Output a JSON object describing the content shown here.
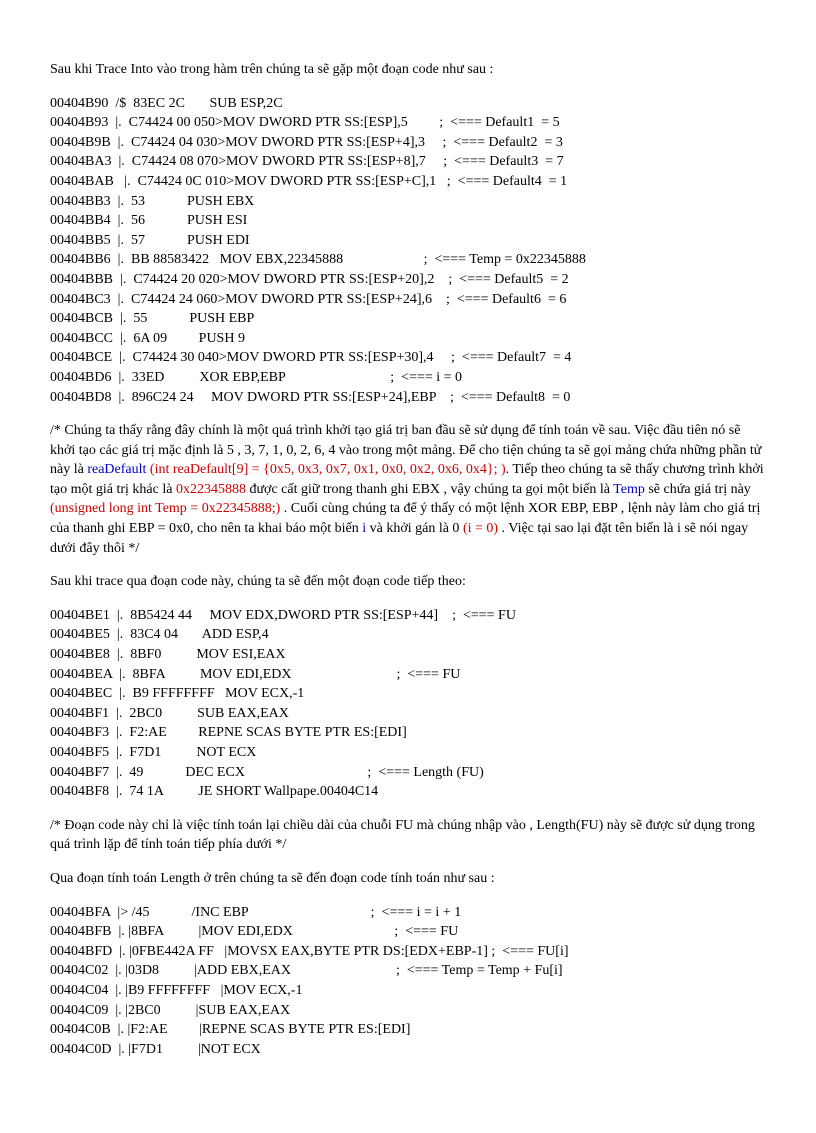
{
  "p1": "Sau khi Trace Into vào trong hàm trên chúng ta sẽ gặp một đoạn code như sau :",
  "code1": "00404B90  /$  83EC 2C       SUB ESP,2C\n00404B93  |.  C74424 00 050>MOV DWORD PTR SS:[ESP],5         ;  <=== Default1  = 5\n00404B9B  |.  C74424 04 030>MOV DWORD PTR SS:[ESP+4],3     ;  <=== Default2  = 3\n00404BA3  |.  C74424 08 070>MOV DWORD PTR SS:[ESP+8],7     ;  <=== Default3  = 7\n00404BAB   |.  C74424 0C 010>MOV DWORD PTR SS:[ESP+C],1   ;  <=== Default4  = 1\n00404BB3  |.  53            PUSH EBX\n00404BB4  |.  56            PUSH ESI\n00404BB5  |.  57            PUSH EDI\n00404BB6  |.  BB 88583422   MOV EBX,22345888                       ;  <=== Temp = 0x22345888\n00404BBB  |.  C74424 20 020>MOV DWORD PTR SS:[ESP+20],2    ;  <=== Default5  = 2\n00404BC3  |.  C74424 24 060>MOV DWORD PTR SS:[ESP+24],6    ;  <=== Default6  = 6\n00404BCB  |.  55            PUSH EBP\n00404BCC  |.  6A 09         PUSH 9\n00404BCE  |.  C74424 30 040>MOV DWORD PTR SS:[ESP+30],4     ;  <=== Default7  = 4\n00404BD6  |.  33ED          XOR EBP,EBP                              ;  <=== i = 0\n00404BD8  |.  896C24 24     MOV DWORD PTR SS:[ESP+24],EBP    ;  <=== Default8  = 0",
  "p2a": "/* Chúng ta thấy rằng đây chính là một quá trình khởi tạo giá trị ban đầu sẽ sử dụng để tính toán về sau.  Việc đầu tiên nó sẽ khởi tạo các giá trị mặc định là 5 , 3, 7, 1, 0, 2, 6, 4 vào trong  một mảng.  Để cho tiện chúng ta sẽ gọi mảng chứa những phần tử này là ",
  "p2b": "reaDefault",
  "p2c": " (int reaDefault[9]  = {0x5, 0x3, 0x7, 0x1, 0x0, 0x2, 0x6, 0x4}; )",
  "p2d": ". Tiếp theo chúng ta sẽ thấy chương trình khởi tạo một giá trị khác là ",
  "p2e": "0x22345888",
  "p2f": " được cất giữ trong thanh ghi EBX , vậy chúng ta gọi một biến là ",
  "p2g": "Temp",
  "p2h": " sẽ chứa giá trị này ",
  "p2i": "(unsigned long int Temp = 0x22345888;)",
  "p2j": " . Cuối cùng chúng ta để ý thấy có một lệnh XOR EBP, EBP , lệnh này làm cho giá trị của thanh ghi EBP = 0x0, cho nên ta khai báo một biến ",
  "p2k": "i",
  "p2l": " và khởi gán là 0 ",
  "p2m": "(i = 0)",
  "p2n": " . Việc tại sao lại đặt tên biến là i sẽ nói ngay dưới đây thôi */",
  "p3": "Sau khi trace qua đoạn code này, chúng ta sẽ đến một đoạn code tiếp theo:",
  "code2": "00404BE1  |.  8B5424 44     MOV EDX,DWORD PTR SS:[ESP+44]    ;  <=== FU\n00404BE5  |.  83C4 04       ADD ESP,4\n00404BE8  |.  8BF0          MOV ESI,EAX\n00404BEA  |.  8BFA          MOV EDI,EDX                              ;  <=== FU\n00404BEC  |.  B9 FFFFFFFF   MOV ECX,-1\n00404BF1  |.  2BC0          SUB EAX,EAX\n00404BF3  |.  F2:AE         REPNE SCAS BYTE PTR ES:[EDI]\n00404BF5  |.  F7D1          NOT ECX\n00404BF7  |.  49            DEC ECX                                   ;  <=== Length (FU)\n00404BF8  |.  74 1A          JE SHORT Wallpape.00404C14",
  "p4": "/* Đoạn code này chỉ là việc tính toán lại chiều dài của chuỗi FU mà chúng nhập vào , Length(FU) này sẽ được sử dụng trong quá trình lặp để tính toán tiếp phía dưới */",
  "p5": "Qua đoạn tính toán Length ở trên chúng ta sẽ đến đoạn code tính toán như sau :",
  "code3": "00404BFA  |> /45            /INC EBP                                   ;  <=== i = i + 1\n00404BFB  |. |8BFA          |MOV EDI,EDX                             ;  <=== FU\n00404BFD  |. |0FBE442A FF   |MOVSX EAX,BYTE PTR DS:[EDX+EBP-1] ;  <=== FU[i]\n00404C02  |. |03D8          |ADD EBX,EAX                              ;  <=== Temp = Temp + Fu[i]\n00404C04  |. |B9 FFFFFFFF   |MOV ECX,-1\n00404C09  |. |2BC0          |SUB EAX,EAX\n00404C0B  |. |F2:AE         |REPNE SCAS BYTE PTR ES:[EDI]\n00404C0D  |. |F7D1          |NOT ECX"
}
